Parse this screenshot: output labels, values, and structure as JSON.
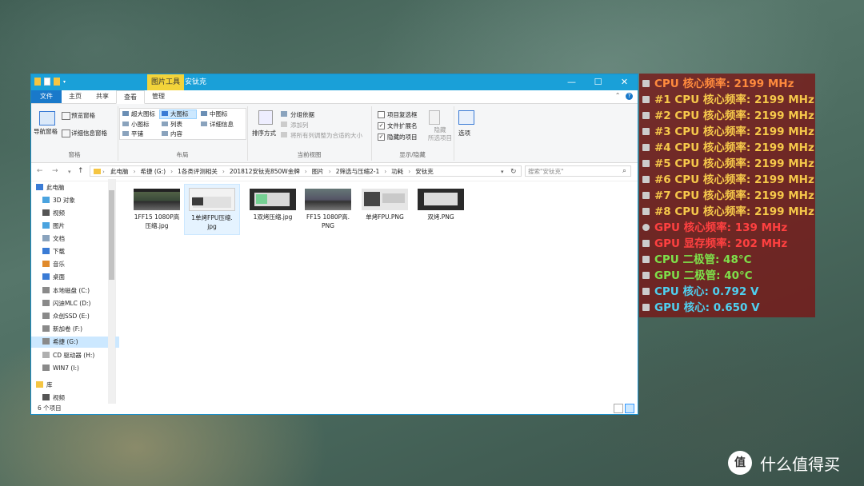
{
  "window": {
    "context_tab": "图片工具",
    "title": "安钛克",
    "buttons": {
      "minimize": "—",
      "maximize": "☐",
      "close": "✕"
    }
  },
  "ribbon_tabs": [
    "文件",
    "主页",
    "共享",
    "查看",
    "管理"
  ],
  "ribbon": {
    "pane_group": {
      "nav_pane": "导航窗格",
      "preview": "预览窗格",
      "details": "详细信息窗格",
      "label": "窗格"
    },
    "layout_group": {
      "items": [
        "超大图标",
        "大图标",
        "中图标",
        "小图标",
        "列表",
        "详细信息",
        "平铺",
        "内容"
      ],
      "label": "布局"
    },
    "current_view_group": {
      "sort": "排序方式",
      "group_by": "分组依据",
      "add_column": "添加列",
      "fit_columns": "将所有列调整为合适的大小",
      "label": "当前视图"
    },
    "show_hide_group": {
      "item_checkbox": "项目复选框",
      "file_ext": "文件扩展名",
      "hidden_items": "隐藏的项目",
      "hide_selected": "隐藏\n所选项目",
      "label": "显示/隐藏",
      "checked": [
        false,
        true,
        true
      ]
    },
    "options": "选项"
  },
  "address": {
    "crumbs": [
      "此电脑",
      "希捷 (G:)",
      "1各类评测相关",
      "201812安钛克850W金牌",
      "图片",
      "2筛选与压缩2-1",
      "功耗",
      "安钛克"
    ],
    "search_placeholder": "搜索\"安钛克\""
  },
  "nav_items": [
    {
      "label": "此电脑",
      "icon": "computer-icon"
    },
    {
      "label": "3D 对象",
      "icon": "cube-icon"
    },
    {
      "label": "视频",
      "icon": "video-icon"
    },
    {
      "label": "图片",
      "icon": "picture-icon"
    },
    {
      "label": "文档",
      "icon": "document-icon"
    },
    {
      "label": "下载",
      "icon": "download-icon"
    },
    {
      "label": "音乐",
      "icon": "music-icon"
    },
    {
      "label": "桌面",
      "icon": "desktop-icon"
    },
    {
      "label": "本地磁盘 (C:)",
      "icon": "drive-icon"
    },
    {
      "label": "闪迪MLC (D:)",
      "icon": "drive-icon"
    },
    {
      "label": "众创SSD (E:)",
      "icon": "drive-icon"
    },
    {
      "label": "新加卷 (F:)",
      "icon": "drive-icon"
    },
    {
      "label": "希捷 (G:)",
      "icon": "drive-icon"
    },
    {
      "label": "CD 驱动器 (H:)",
      "icon": "cd-icon"
    },
    {
      "label": "WIN7 (I:)",
      "icon": "drive-icon"
    },
    {
      "label": "库",
      "icon": "library-icon"
    },
    {
      "label": "视频",
      "icon": "video-icon"
    }
  ],
  "files": [
    {
      "name": "1FF15 1080P高\n压缩.jpg"
    },
    {
      "name": "1单烤FPU压缩.\njpg"
    },
    {
      "name": "1双烤压缩.jpg"
    },
    {
      "name": "FF15 1080P高.\nPNG"
    },
    {
      "name": "单烤FPU.PNG"
    },
    {
      "name": "双烤.PNG"
    }
  ],
  "status": "6 个项目",
  "osd": [
    {
      "text": "CPU 核心频率: 2199 MHz",
      "color": "#ff8a3d"
    },
    {
      "text": "#1 CPU 核心频率: 2199 MHz",
      "color": "#f6c84a"
    },
    {
      "text": "#2 CPU 核心频率: 2199 MHz",
      "color": "#f6c84a"
    },
    {
      "text": "#3 CPU 核心频率: 2199 MHz",
      "color": "#f6c84a"
    },
    {
      "text": "#4 CPU 核心频率: 2199 MHz",
      "color": "#f6c84a"
    },
    {
      "text": "#5 CPU 核心频率: 2199 MHz",
      "color": "#f6c84a"
    },
    {
      "text": "#6 CPU 核心频率: 2199 MHz",
      "color": "#f6c84a"
    },
    {
      "text": "#7 CPU 核心频率: 2199 MHz",
      "color": "#f6c84a"
    },
    {
      "text": "#8 CPU 核心频率: 2199 MHz",
      "color": "#f6c84a"
    },
    {
      "text": "GPU 核心频率: 139 MHz",
      "color": "#ff4040"
    },
    {
      "text": "GPU 显存频率: 202 MHz",
      "color": "#ff4040"
    },
    {
      "text": "CPU 二极管: 48°C",
      "color": "#7ee04a"
    },
    {
      "text": "GPU 二极管: 40°C",
      "color": "#7ee04a"
    },
    {
      "text": "CPU 核心: 0.792 V",
      "color": "#4fd0f0"
    },
    {
      "text": "GPU 核心: 0.650 V",
      "color": "#4fd0f0"
    }
  ],
  "watermark": {
    "logo": "值",
    "text": "什么值得买"
  }
}
